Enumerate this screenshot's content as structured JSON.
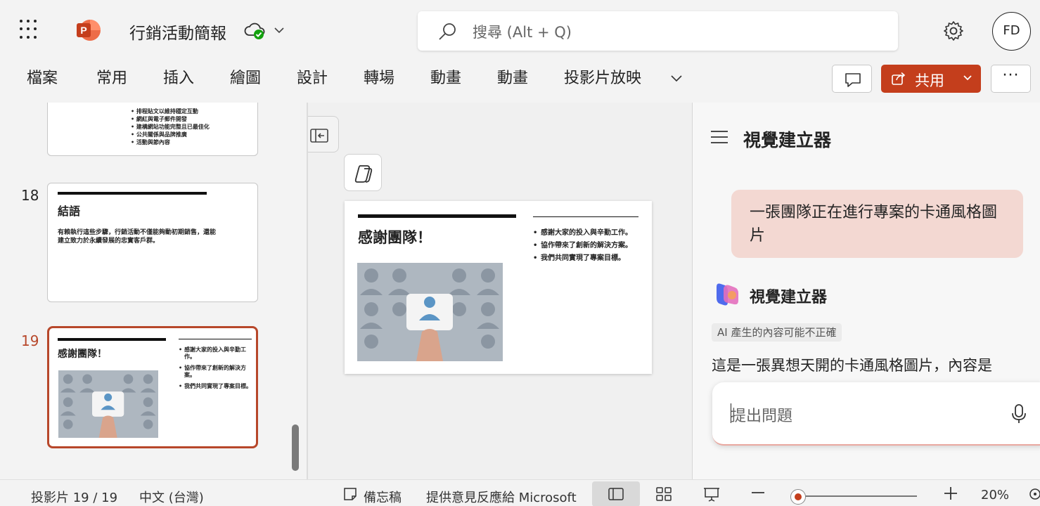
{
  "app": {
    "brand_color": "#c43e1c",
    "accent_border": "#b7472a"
  },
  "titlebar": {
    "doc_title": "行銷活動簡報",
    "search_placeholder": "搜尋 (Alt + Q)",
    "avatar_initials": "FD"
  },
  "ribbon": {
    "tabs": [
      "檔案",
      "常用",
      "插入",
      "繪圖",
      "設計",
      "轉場",
      "動畫",
      "動畫",
      "投影片放映"
    ],
    "share_label": "共用",
    "more_label": "···"
  },
  "thumbnails": {
    "slide17_bullets": [
      "排程貼文以維持穩定互動",
      "網紅與電子郵件開發",
      "建構網站功能完整且已最佳化",
      "公共關係與品牌推廣",
      "活動與節內容"
    ],
    "slide18": {
      "number": "18",
      "title": "結語",
      "body": "有賴執行這些步驟，行銷活動不僅能夠動初期銷售，還能建立致力於永續發展的忠實客戶群。"
    },
    "slide19": {
      "number": "19",
      "title": "感謝團隊！",
      "bullets": [
        "感謝大家的投入與辛勤工作。",
        "協作帶來了創新的解決方案。",
        "我們共同實現了專案目標。"
      ]
    }
  },
  "slide": {
    "title": "感謝團隊！",
    "bullets": [
      "感謝大家的投入與辛勤工作。",
      "協作帶來了創新的解決方案。",
      "我們共同實現了專案目標。"
    ]
  },
  "copilot": {
    "pane_title": "視覺建立器",
    "user_message": "一張團隊正在進行專案的卡通風格圖片",
    "bot_name": "視覺建立器",
    "ai_disclaimer": "AI 產生的內容可能不正確",
    "bot_message": "這是一張異想天開的卡通風格圖片，內容是",
    "input_placeholder": "提出問題"
  },
  "statusbar": {
    "slide_counter": "投影片 19 / 19",
    "language": "中文 (台灣)",
    "notes": "備忘稿",
    "feedback": "提供意見反應給 Microsoft",
    "zoom_level": "20%"
  }
}
